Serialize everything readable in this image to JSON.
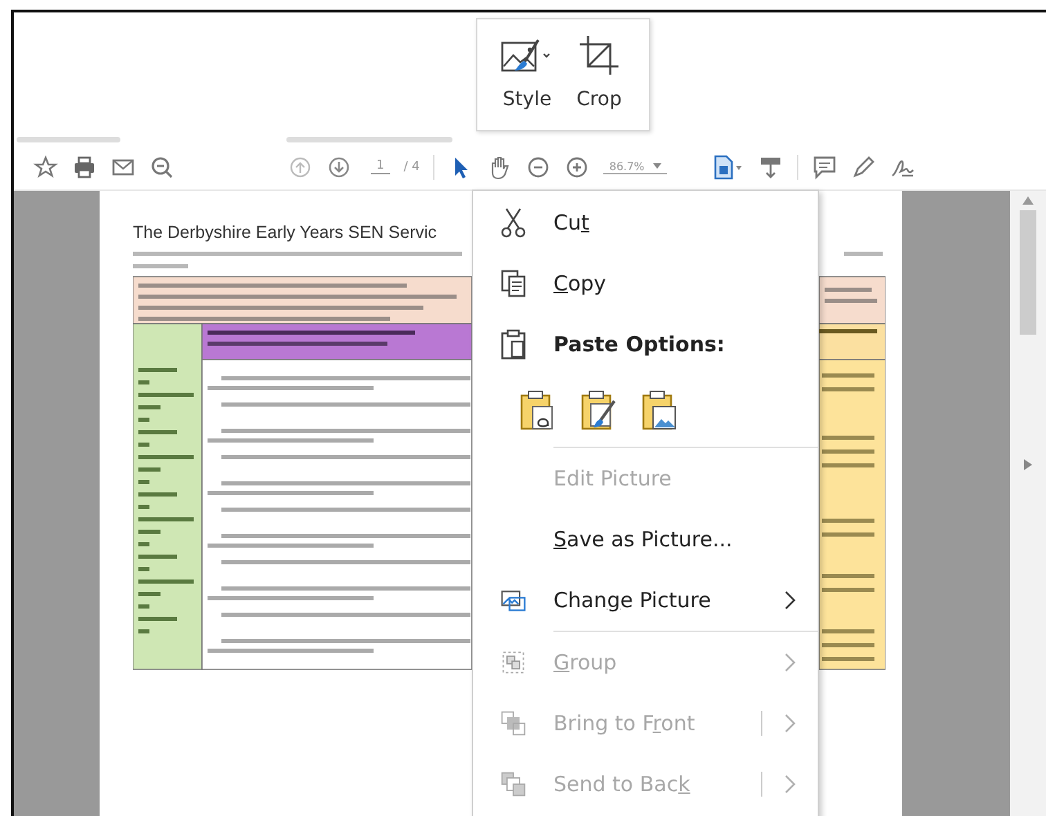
{
  "mini_toolbar": {
    "buttons": [
      {
        "kind": "style",
        "label": "Style"
      },
      {
        "kind": "crop",
        "label": "Crop"
      }
    ]
  },
  "viewer": {
    "toolbar": {
      "page_field": "1",
      "page_total": "/ 4",
      "zoom": "86.7%"
    },
    "document": {
      "title": "The Derbyshire Early Years SEN Servic"
    }
  },
  "context_menu": {
    "items": [
      {
        "kind": "cut",
        "before": "Cu",
        "key": "t",
        "disabled": false,
        "submenu": false,
        "split": false
      },
      {
        "kind": "copy",
        "key": "C",
        "after": "opy",
        "disabled": false,
        "submenu": false,
        "split": false
      },
      {
        "kind": "heading",
        "label": "Paste Options:"
      },
      {
        "kind": "paste_options",
        "options": [
          {
            "kind": "keep-text"
          },
          {
            "kind": "brush"
          },
          {
            "kind": "picture"
          }
        ]
      },
      {
        "kind": "separator"
      },
      {
        "kind": "plain",
        "before": "Edit Picture",
        "disabled": true,
        "submenu": false,
        "split": false
      },
      {
        "kind": "plain",
        "key": "S",
        "after": "ave as Picture...",
        "disabled": false,
        "submenu": false,
        "split": false
      },
      {
        "kind": "change",
        "before": "Chan",
        "key": "g",
        "after": "e Picture",
        "disabled": false,
        "submenu": true,
        "split": false
      },
      {
        "kind": "separator"
      },
      {
        "kind": "group",
        "key": "G",
        "after": "roup",
        "disabled": true,
        "submenu": true,
        "split": false
      },
      {
        "kind": "front",
        "before": "Bring to F",
        "key": "r",
        "after": "ont",
        "disabled": true,
        "submenu": true,
        "split": true
      },
      {
        "kind": "back",
        "before": "Send to Bac",
        "key": "k",
        "disabled": true,
        "submenu": true,
        "split": true
      }
    ]
  }
}
